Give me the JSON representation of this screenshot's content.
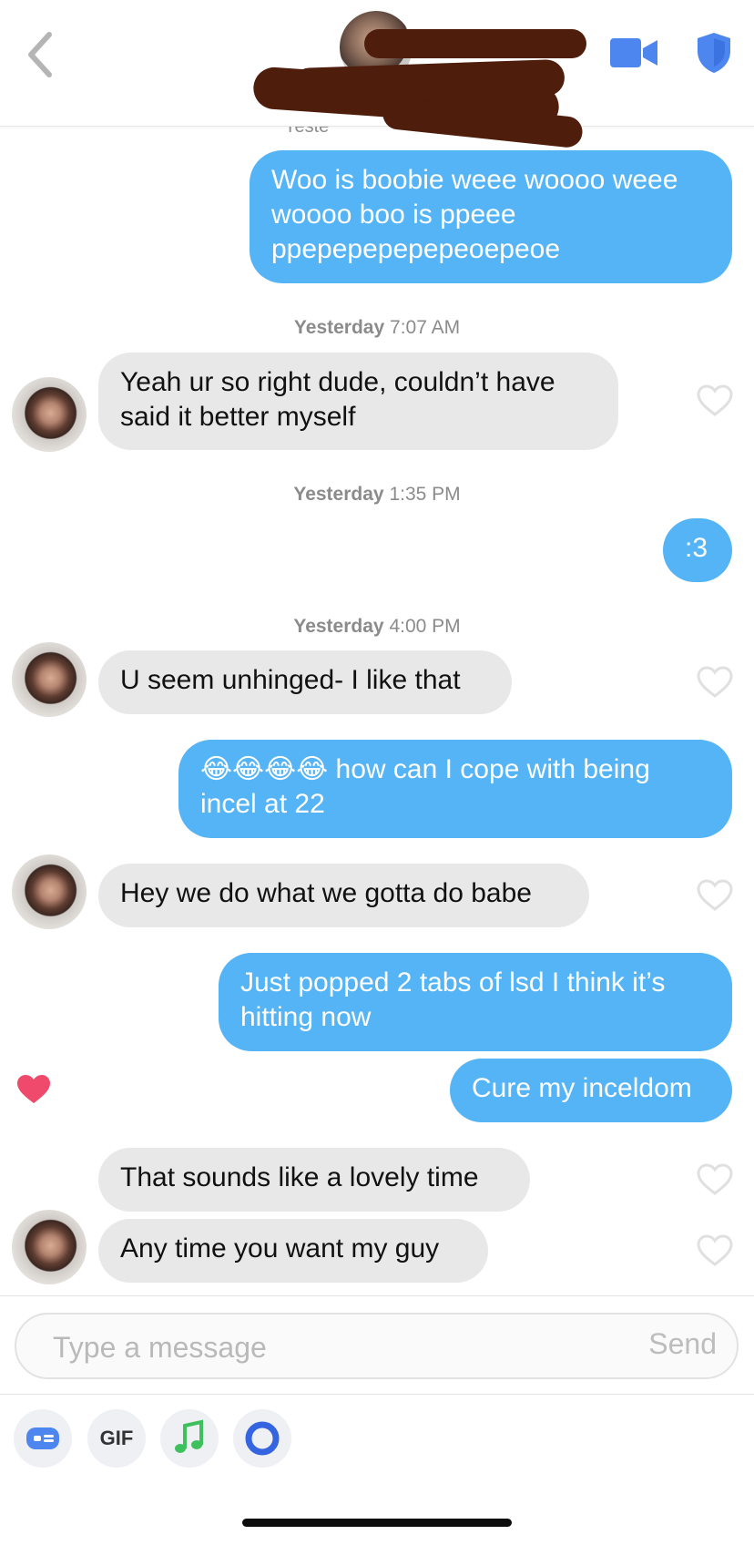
{
  "header": {
    "back_icon": "chevron-left-icon",
    "video_icon": "video-camera-icon",
    "safety_icon": "shield-icon",
    "brand_color": "#4e86f0",
    "faint_text": "Yeste"
  },
  "messages": {
    "m1": "Woo is boobie weee woooo weee woooo boo is ppeee ppepepepepepeoepeoe",
    "ts1": {
      "day": "Yesterday",
      "time": "7:07 AM"
    },
    "m2": "Yeah ur so right dude, couldn’t have said it better myself",
    "ts2": {
      "day": "Yesterday",
      "time": "1:35 PM"
    },
    "m3": ":3",
    "ts3": {
      "day": "Yesterday",
      "time": "4:00 PM"
    },
    "m4": "U seem unhinged- I like that",
    "m5_emoji": "😂😂😂😂",
    "m5": " how can I cope with being incel at 22",
    "m6": "Hey we do what we gotta do babe",
    "m7": "Just popped 2 tabs of lsd I think it’s hitting now",
    "m8": "Cure my inceldom",
    "m9": "That sounds like a lovely time",
    "m10": "Any time you want my guy",
    "liked_message": "Cure my inceldom"
  },
  "colors": {
    "outgoing_bubble": "#55b4f5",
    "incoming_bubble": "#e8e8e8",
    "like_heart": "#ef4a6b"
  },
  "composer": {
    "placeholder": "Type a message",
    "send_label": "Send",
    "tools": [
      "contact-card-icon",
      "GIF",
      "music-note-icon",
      "loop-icon"
    ],
    "gif_label": "GIF"
  }
}
